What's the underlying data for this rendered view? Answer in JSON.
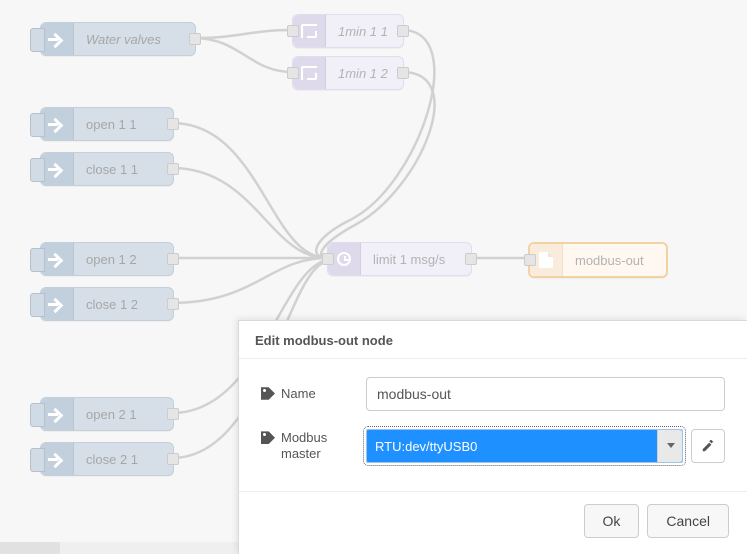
{
  "nodes": {
    "water": {
      "label": "Water valves"
    },
    "t11": {
      "label": "1min 1 1"
    },
    "t12": {
      "label": "1min 1 2"
    },
    "open11": {
      "label": "open 1 1"
    },
    "close11": {
      "label": "close 1 1"
    },
    "open12": {
      "label": "open 1 2"
    },
    "close12": {
      "label": "close 1 2"
    },
    "open21": {
      "label": "open 2 1"
    },
    "close21": {
      "label": "close 2 1"
    },
    "limit": {
      "label": "limit 1 msg/s"
    },
    "modbus": {
      "label": "modbus-out"
    }
  },
  "panel": {
    "title": "Edit modbus-out node",
    "name_label": "Name",
    "name_value": "modbus-out",
    "master_label": "Modbus master",
    "master_value": "RTU:dev/ttyUSB0",
    "ok": "Ok",
    "cancel": "Cancel"
  },
  "colors": {
    "modbus_border": "#e69a32",
    "select_highlight": "#1e90ff"
  }
}
